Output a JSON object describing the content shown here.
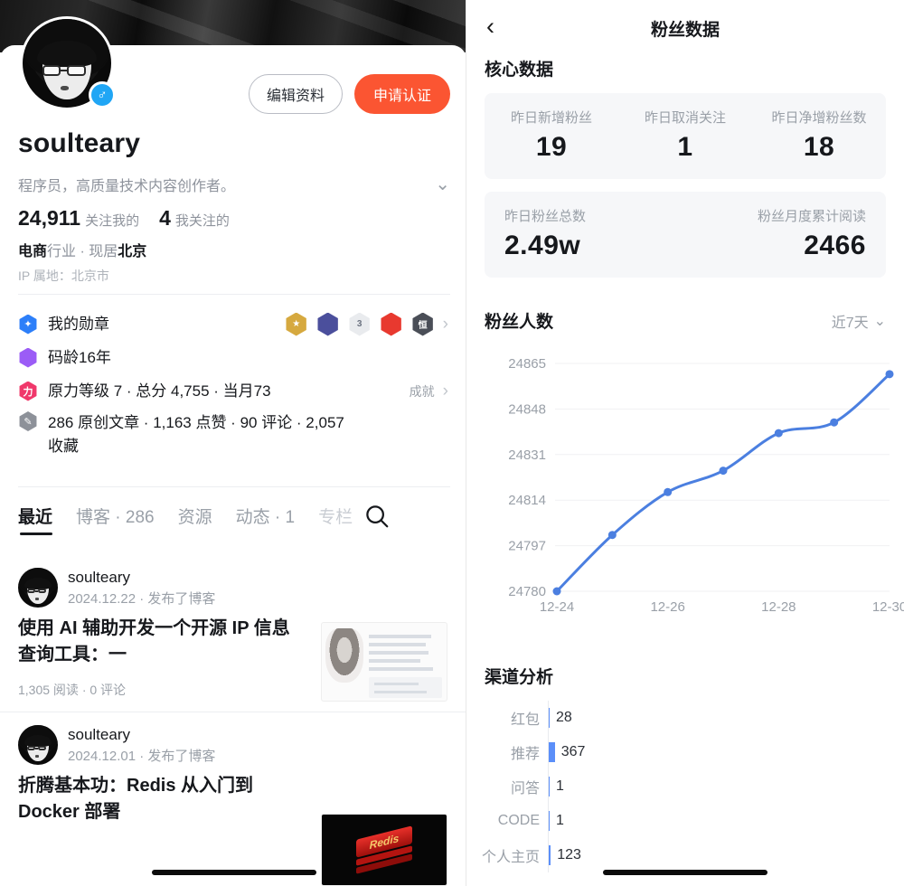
{
  "profile": {
    "avatar_alt": "avatar",
    "gender_icon": "male-icon",
    "edit_button": "编辑资料",
    "verify_button": "申请认证",
    "verify_button_color": "#fb5532",
    "username": "soulteary",
    "bio": "程序员，高质量技术内容创作者。",
    "expand_icon": "chevron-down-icon",
    "followers_count": "24,911",
    "followers_label": "关注我的",
    "following_count": "4",
    "following_label": "我关注的",
    "industry_bold1": "电商",
    "industry_plain1": "行业",
    "separator": " · ",
    "industry_plain2": "现居",
    "industry_bold2": "北京",
    "ip_location": "IP 属地：北京市"
  },
  "rows": [
    {
      "icon": "medal-icon",
      "icon_color": "#2d7ff9",
      "icon_glyph": "✦",
      "label": "我的勋章",
      "right_type": "medals",
      "chevron": "chevron-right-icon"
    },
    {
      "icon": "coder-age-icon",
      "icon_color": "#9b5cf6",
      "icon_glyph": "",
      "label": "码龄16年",
      "right_type": "none"
    },
    {
      "icon": "force-level-icon",
      "icon_color": "#f0386b",
      "icon_glyph": "力",
      "label": "原力等级 7 · 总分 4,755 · 当月73",
      "right_type": "link",
      "right_label": "成就",
      "chevron": "chevron-right-icon"
    },
    {
      "icon": "article-icon",
      "icon_color": "#8d9199",
      "icon_glyph": "✎",
      "label": "286 原创文章 · 1,163 点赞 · 90 评论 · 2,057 收藏",
      "right_type": "none"
    }
  ],
  "medals": [
    {
      "name": "gold-star-medal",
      "color": "#d6a93f",
      "glyph": "★"
    },
    {
      "name": "blue-hexagon-medal",
      "color": "#4b4f9c",
      "glyph": ""
    },
    {
      "name": "rainbow-3-medal",
      "color": "#e9ebee",
      "glyph": "3"
    },
    {
      "name": "red-flame-medal",
      "color": "#e8392f",
      "glyph": ""
    },
    {
      "name": "dark-book-medal",
      "color": "#4a4e57",
      "glyph": "恒"
    }
  ],
  "tabs": [
    {
      "label": "最近",
      "active": true
    },
    {
      "label": "博客 · 286",
      "active": false
    },
    {
      "label": "资源",
      "active": false
    },
    {
      "label": "动态 · 1",
      "active": false
    },
    {
      "label": "专栏",
      "active": false,
      "faded": true
    }
  ],
  "search_icon": "search-icon",
  "posts": [
    {
      "author": "soulteary",
      "date": "2024.12.22 · 发布了博客",
      "title": "使用 AI 辅助开发一个开源 IP 信息查询工具：一",
      "stats": "1,305 阅读 · 0 评论",
      "thumb": "ip-tool-screenshot-thumbnail"
    },
    {
      "author": "soulteary",
      "date": "2024.12.01 · 发布了博客",
      "title": "折腾基本功：Redis 从入门到 Docker 部署",
      "stats": "",
      "thumb": "redis-logo-thumbnail"
    }
  ],
  "fan_data": {
    "back_icon": "back-chevron-icon",
    "nav_title": "粉丝数据",
    "core_title": "核心数据",
    "core_cards": [
      [
        {
          "key": "昨日新增粉丝",
          "value": "19"
        },
        {
          "key": "昨日取消关注",
          "value": "1"
        },
        {
          "key": "昨日净增粉丝数",
          "value": "18"
        }
      ],
      [
        {
          "key": "昨日粉丝总数",
          "value": "2.49w"
        },
        {
          "key": "粉丝月度累计阅读",
          "value": "2466"
        }
      ]
    ],
    "chart_title": "粉丝人数",
    "range_label": "近7天",
    "range_icon": "chevron-down-icon",
    "channel_title": "渠道分析"
  },
  "chart_data": {
    "type": "line",
    "title": "粉丝人数",
    "xlabel": "",
    "ylabel": "",
    "x": [
      "12-24",
      "12-25",
      "12-26",
      "12-27",
      "12-28",
      "12-29",
      "12-30"
    ],
    "tick_labels_shown": [
      "12-24",
      "",
      "12-26",
      "",
      "12-28",
      "",
      "12-30"
    ],
    "values": [
      24780,
      24801,
      24817,
      24825,
      24839,
      24843,
      24861
    ],
    "yticks": [
      24780,
      24797,
      24814,
      24831,
      24848,
      24865
    ],
    "ylim": [
      24780,
      24865
    ],
    "line_color": "#4b7fe0",
    "point_color": "#4b7fe0",
    "grid": true,
    "legend": "none"
  },
  "channel_chart": {
    "type": "bar",
    "orientation": "horizontal",
    "title": "渠道分析",
    "categories": [
      "红包",
      "推荐",
      "问答",
      "CODE",
      "个人主页"
    ],
    "values": [
      28,
      367,
      1,
      1,
      123
    ],
    "bar_color": "#5b8ff9",
    "max": 367
  }
}
